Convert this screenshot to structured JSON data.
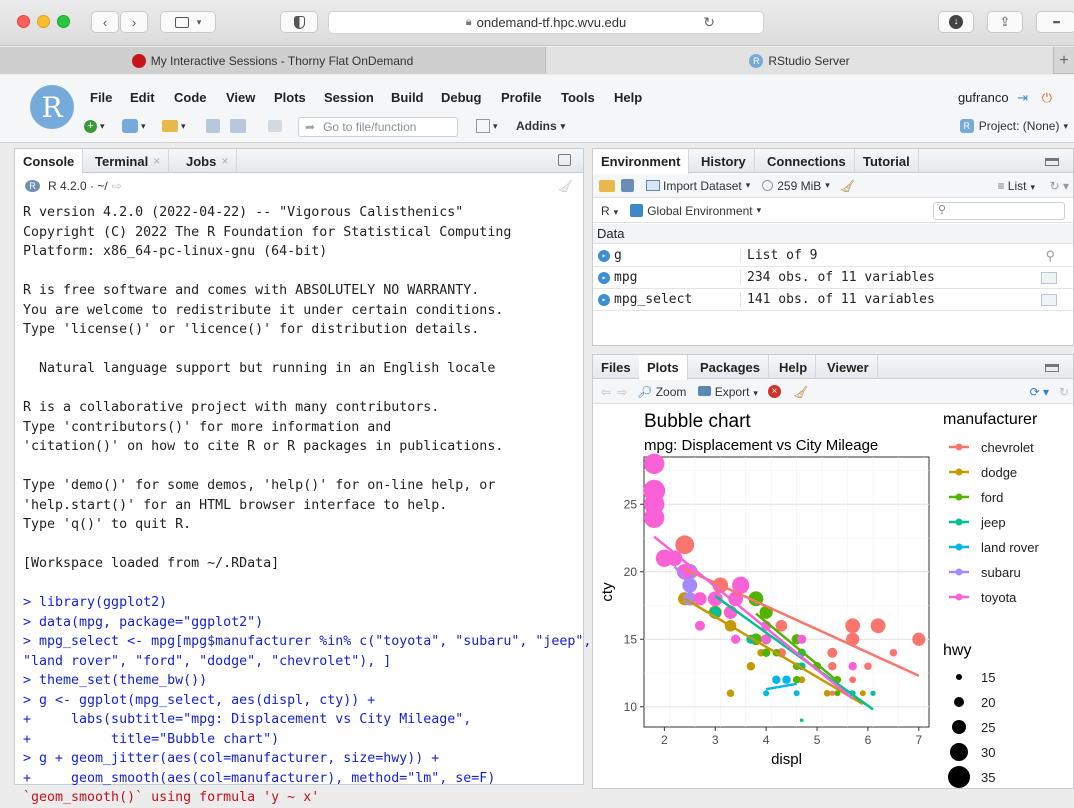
{
  "browser": {
    "url": "ondemand-tf.hpc.wvu.edu",
    "tabs": [
      {
        "label": "My Interactive Sessions - Thorny Flat OnDemand"
      },
      {
        "label": "RStudio Server"
      }
    ]
  },
  "rstudio": {
    "menu": [
      "File",
      "Edit",
      "Code",
      "View",
      "Plots",
      "Session",
      "Build",
      "Debug",
      "Profile",
      "Tools",
      "Help"
    ],
    "user": "gufranco",
    "goto_placeholder": "Go to file/function",
    "addins": "Addins",
    "project": "Project: (None)"
  },
  "console": {
    "tabs": [
      "Console",
      "Terminal",
      "Jobs"
    ],
    "version": "R 4.2.0 · ~/",
    "lines": [
      {
        "t": "R version 4.2.0 (2022-04-22) -- \"Vigorous Calisthenics\"",
        "c": ""
      },
      {
        "t": "Copyright (C) 2022 The R Foundation for Statistical Computing",
        "c": ""
      },
      {
        "t": "Platform: x86_64-pc-linux-gnu (64-bit)",
        "c": ""
      },
      {
        "t": "",
        "c": ""
      },
      {
        "t": "R is free software and comes with ABSOLUTELY NO WARRANTY.",
        "c": ""
      },
      {
        "t": "You are welcome to redistribute it under certain conditions.",
        "c": ""
      },
      {
        "t": "Type 'license()' or 'licence()' for distribution details.",
        "c": ""
      },
      {
        "t": "",
        "c": ""
      },
      {
        "t": "  Natural language support but running in an English locale",
        "c": ""
      },
      {
        "t": "",
        "c": ""
      },
      {
        "t": "R is a collaborative project with many contributors.",
        "c": ""
      },
      {
        "t": "Type 'contributors()' for more information and",
        "c": ""
      },
      {
        "t": "'citation()' on how to cite R or R packages in publications.",
        "c": ""
      },
      {
        "t": "",
        "c": ""
      },
      {
        "t": "Type 'demo()' for some demos, 'help()' for on-line help, or",
        "c": ""
      },
      {
        "t": "'help.start()' for an HTML browser interface to help.",
        "c": ""
      },
      {
        "t": "Type 'q()' to quit R.",
        "c": ""
      },
      {
        "t": "",
        "c": ""
      },
      {
        "t": "[Workspace loaded from ~/.RData]",
        "c": ""
      },
      {
        "t": "",
        "c": ""
      },
      {
        "t": "> library(ggplot2)",
        "c": "blue"
      },
      {
        "t": "> data(mpg, package=\"ggplot2\")",
        "c": "blue"
      },
      {
        "t": "> mpg_select <- mpg[mpg$manufacturer %in% c(\"toyota\", \"subaru\", \"jeep\",",
        "c": "blue"
      },
      {
        "t": "\"land rover\", \"ford\", \"dodge\", \"chevrolet\"), ]",
        "c": "blue"
      },
      {
        "t": "> theme_set(theme_bw())",
        "c": "blue"
      },
      {
        "t": "> g <- ggplot(mpg_select, aes(displ, cty)) +",
        "c": "blue"
      },
      {
        "t": "+     labs(subtitle=\"mpg: Displacement vs City Mileage\",",
        "c": "blue"
      },
      {
        "t": "+          title=\"Bubble chart\")",
        "c": "blue"
      },
      {
        "t": "> g + geom_jitter(aes(col=manufacturer, size=hwy)) +",
        "c": "blue"
      },
      {
        "t": "+     geom_smooth(aes(col=manufacturer), method=\"lm\", se=F)",
        "c": "blue"
      },
      {
        "t": "`geom_smooth()` using formula 'y ~ x'",
        "c": "red"
      }
    ]
  },
  "environment": {
    "tabs": [
      "Environment",
      "History",
      "Connections",
      "Tutorial"
    ],
    "import_dataset": "Import Dataset",
    "memory": "259 MiB",
    "list_label": "List",
    "r_label": "R",
    "global_env": "Global Environment",
    "section": "Data",
    "rows": [
      {
        "name": "g",
        "value": "List of  9"
      },
      {
        "name": "mpg",
        "value": "234 obs. of 11 variables"
      },
      {
        "name": "mpg_select",
        "value": "141 obs. of 11 variables"
      }
    ]
  },
  "files": {
    "tabs": [
      "Files",
      "Plots",
      "Packages",
      "Help",
      "Viewer"
    ],
    "zoom": "Zoom",
    "export": "Export"
  },
  "chart_data": {
    "type": "scatter",
    "title": "Bubble chart",
    "subtitle": "mpg: Displacement vs City Mileage",
    "xlabel": "displ",
    "ylabel": "cty",
    "xlim": [
      1.6,
      7.2
    ],
    "ylim": [
      8.5,
      28.5
    ],
    "xticks": [
      2,
      3,
      4,
      5,
      6,
      7
    ],
    "yticks": [
      10,
      15,
      20,
      25
    ],
    "grid": true,
    "legend_color_title": "manufacturer",
    "legend_size_title": "hwy",
    "size_levels": [
      15,
      20,
      25,
      30,
      35
    ],
    "series": [
      {
        "name": "chevrolet",
        "color": "#F8766D",
        "points": [
          [
            2.4,
            22,
            31
          ],
          [
            3.1,
            19,
            27
          ],
          [
            3.8,
            18,
            26
          ],
          [
            4.3,
            16,
            22
          ],
          [
            5.3,
            14,
            20
          ],
          [
            5.7,
            16,
            26
          ],
          [
            5.7,
            15,
            24
          ],
          [
            6.0,
            13,
            17
          ],
          [
            6.2,
            16,
            26
          ],
          [
            6.5,
            14,
            17
          ],
          [
            7.0,
            15,
            24
          ],
          [
            5.3,
            11,
            14
          ],
          [
            5.3,
            13,
            18
          ],
          [
            4.3,
            14,
            19
          ],
          [
            5.7,
            12,
            16
          ]
        ],
        "line": [
          [
            2.4,
            20.2
          ],
          [
            7.0,
            12.3
          ]
        ]
      },
      {
        "name": "dodge",
        "color": "#C49A00",
        "points": [
          [
            2.4,
            18,
            24
          ],
          [
            3.0,
            17,
            24
          ],
          [
            3.3,
            16,
            22
          ],
          [
            3.3,
            17,
            24
          ],
          [
            3.8,
            15,
            22
          ],
          [
            4.7,
            13,
            17
          ],
          [
            4.7,
            9,
            12
          ],
          [
            5.2,
            11,
            15
          ],
          [
            5.9,
            11,
            15
          ],
          [
            4.7,
            14,
            18
          ],
          [
            3.9,
            14,
            17
          ],
          [
            3.3,
            11,
            17
          ],
          [
            4.7,
            12,
            16
          ],
          [
            5.2,
            11,
            16
          ],
          [
            3.7,
            13,
            18
          ]
        ],
        "line": [
          [
            2.4,
            18.0
          ],
          [
            5.9,
            10.2
          ]
        ]
      },
      {
        "name": "ford",
        "color": "#53B400",
        "points": [
          [
            3.8,
            18,
            26
          ],
          [
            4.0,
            15,
            20
          ],
          [
            4.0,
            14,
            18
          ],
          [
            4.6,
            15,
            20
          ],
          [
            4.6,
            13,
            17
          ],
          [
            5.4,
            11,
            15
          ],
          [
            5.4,
            12,
            17
          ],
          [
            4.2,
            14,
            17
          ],
          [
            4.6,
            12,
            17
          ],
          [
            3.8,
            15,
            22
          ],
          [
            4.0,
            17,
            24
          ],
          [
            5.0,
            13,
            18
          ],
          [
            4.0,
            16,
            19
          ],
          [
            4.6,
            15,
            20
          ]
        ],
        "line": [
          [
            3.8,
            16.9
          ],
          [
            5.4,
            11.9
          ]
        ]
      },
      {
        "name": "jeep",
        "color": "#00C094",
        "points": [
          [
            3.0,
            17,
            22
          ],
          [
            3.7,
            15,
            19
          ],
          [
            4.0,
            15,
            20
          ],
          [
            4.7,
            14,
            17
          ],
          [
            4.7,
            9,
            12
          ],
          [
            5.7,
            11,
            15
          ],
          [
            6.1,
            11,
            14
          ],
          [
            4.7,
            13,
            17
          ]
        ],
        "line": [
          [
            3.0,
            18.2
          ],
          [
            6.1,
            9.8
          ]
        ]
      },
      {
        "name": "land rover",
        "color": "#00B6EB",
        "points": [
          [
            4.0,
            11,
            15
          ],
          [
            4.2,
            12,
            18
          ],
          [
            4.4,
            12,
            18
          ],
          [
            4.6,
            11,
            15
          ]
        ],
        "line": [
          [
            4.0,
            11.3
          ],
          [
            4.6,
            11.7
          ]
        ]
      },
      {
        "name": "subaru",
        "color": "#A58AFF",
        "points": [
          [
            2.2,
            21,
            26
          ],
          [
            2.5,
            19,
            26
          ],
          [
            2.5,
            20,
            26
          ],
          [
            2.5,
            18,
            24
          ],
          [
            2.5,
            18,
            24
          ],
          [
            2.5,
            19,
            25
          ],
          [
            2.5,
            20,
            27
          ],
          [
            2.5,
            18,
            23
          ]
        ],
        "line": [
          [
            2.2,
            20.4
          ],
          [
            2.5,
            19.0
          ]
        ]
      },
      {
        "name": "toyota",
        "color": "#FB61D7",
        "points": [
          [
            1.8,
            28,
            33
          ],
          [
            1.8,
            26,
            35
          ],
          [
            1.8,
            24,
            33
          ],
          [
            1.8,
            25,
            33
          ],
          [
            2.0,
            21,
            29
          ],
          [
            2.2,
            21,
            27
          ],
          [
            2.4,
            20,
            27
          ],
          [
            2.7,
            18,
            24
          ],
          [
            3.0,
            18,
            26
          ],
          [
            3.3,
            17,
            24
          ],
          [
            3.4,
            18,
            26
          ],
          [
            3.5,
            19,
            29
          ],
          [
            4.0,
            16,
            20
          ],
          [
            4.7,
            15,
            19
          ],
          [
            5.7,
            13,
            18
          ],
          [
            2.7,
            16,
            20
          ],
          [
            3.4,
            15,
            19
          ],
          [
            4.0,
            15,
            20
          ]
        ],
        "line": [
          [
            1.8,
            22.6
          ],
          [
            5.7,
            10.6
          ]
        ]
      }
    ]
  }
}
